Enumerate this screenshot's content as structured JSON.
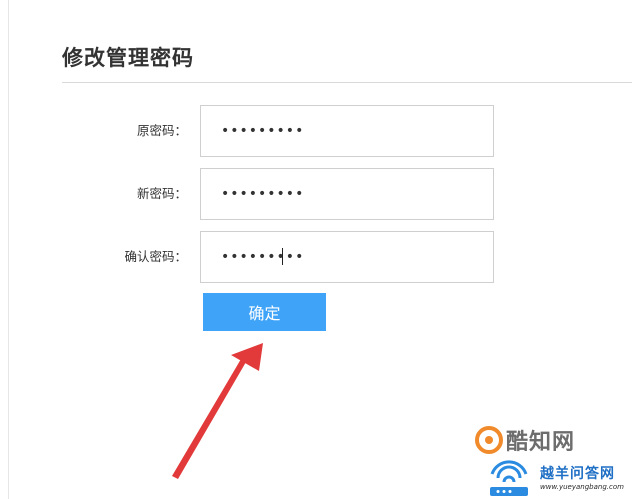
{
  "page": {
    "title": "修改管理密码"
  },
  "form": {
    "rows": [
      {
        "label": "原密码：",
        "value": "•••••••••"
      },
      {
        "label": "新密码：",
        "value": "•••••••••"
      },
      {
        "label": "确认密码：",
        "value": "•••••••••"
      }
    ],
    "confirm_label": "确定"
  },
  "watermark": {
    "brand_top": "酷知网",
    "brand_bottom": "越羊问答网",
    "url": "www.yueyangbang.com"
  },
  "colors": {
    "button": "#3fa3f8",
    "arrow": "#e23a3a",
    "title_text": "#333333"
  },
  "icons": {
    "arrow": "red-arrow-icon",
    "watermark_top": "kuzhi-logo-icon",
    "watermark_bottom": "wifi-router-logo-icon"
  }
}
